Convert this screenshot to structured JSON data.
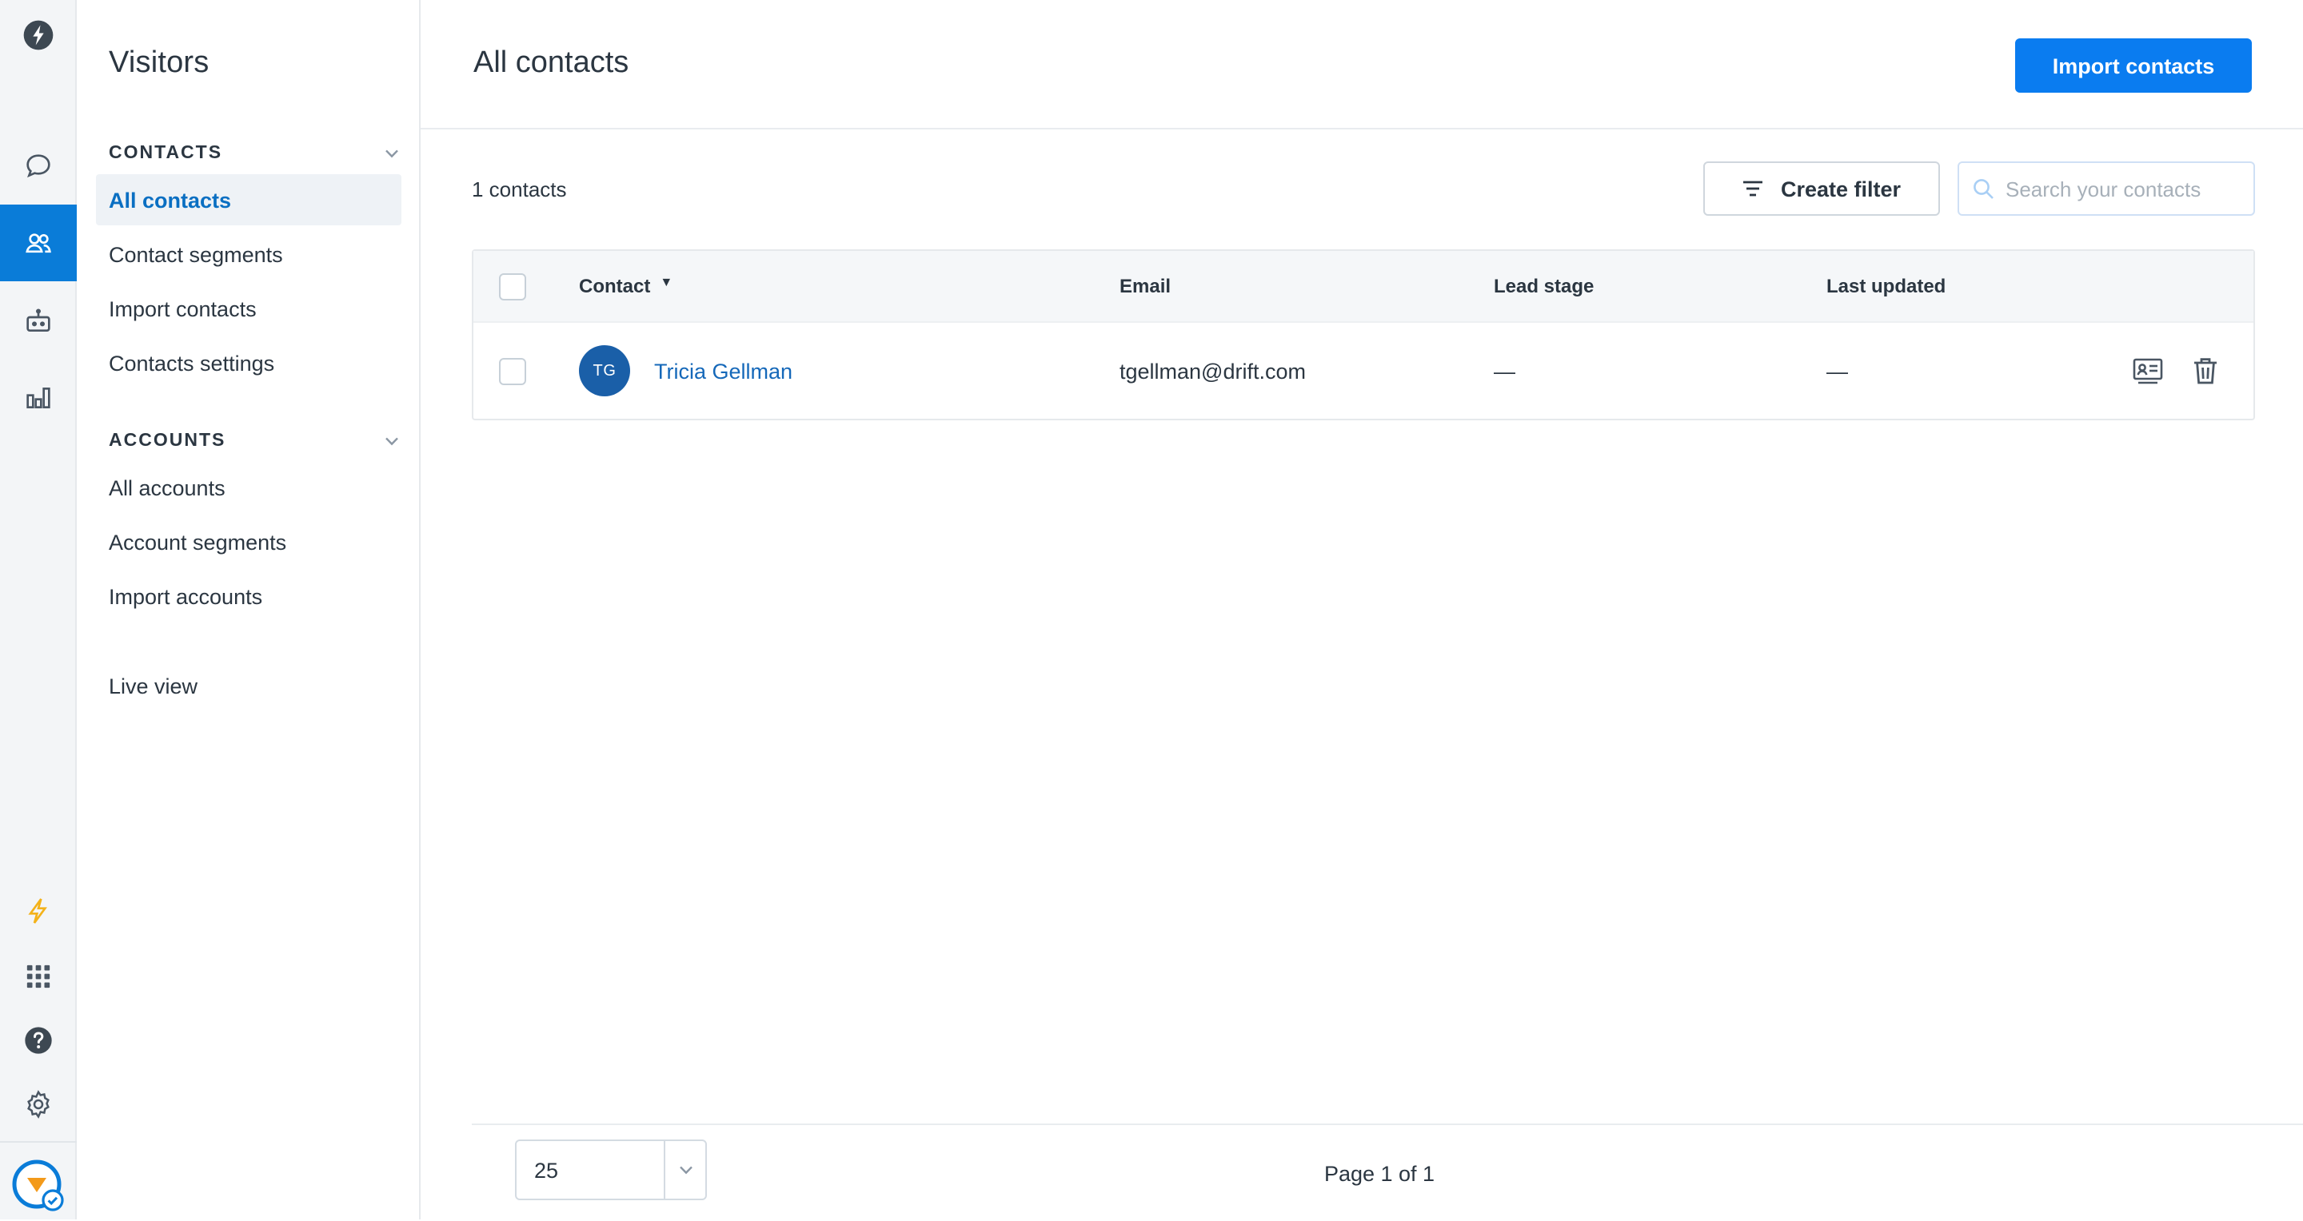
{
  "colors": {
    "accent": "#0a7cf0",
    "rail_active": "#0a7cd8",
    "link": "#1568b9",
    "avatar_bg": "#1a5fa8",
    "bolt_yellow": "#f3b21a"
  },
  "rail": {
    "items": [
      {
        "icon": "drift-logo-icon"
      },
      {
        "icon": "conversations-icon"
      },
      {
        "icon": "contacts-icon",
        "active": true
      },
      {
        "icon": "bot-icon"
      },
      {
        "icon": "reports-icon"
      },
      {
        "icon": "lightning-icon"
      },
      {
        "icon": "apps-grid-icon"
      },
      {
        "icon": "help-icon"
      },
      {
        "icon": "settings-icon"
      },
      {
        "icon": "user-avatar-icon"
      }
    ]
  },
  "subnav": {
    "title": "Visitors",
    "contacts_section": "CONTACTS",
    "contacts_items": [
      "All contacts",
      "Contact segments",
      "Import contacts",
      "Contacts settings"
    ],
    "accounts_section": "ACCOUNTS",
    "accounts_items": [
      "All accounts",
      "Account segments",
      "Import accounts"
    ],
    "live_view": "Live view"
  },
  "header": {
    "title": "All contacts",
    "import_button": "Import contacts"
  },
  "toolbar": {
    "count": "1 contacts",
    "filter_button": "Create filter",
    "search_placeholder": "Search your contacts"
  },
  "table": {
    "columns": [
      "Contact",
      "Email",
      "Lead stage",
      "Last updated"
    ],
    "rows": [
      {
        "initials": "TG",
        "name": "Tricia Gellman",
        "email": "tgellman@drift.com",
        "lead_stage": "—",
        "last_updated": "—"
      }
    ]
  },
  "footer": {
    "per_page": "25",
    "page_info": "Page 1 of 1"
  }
}
